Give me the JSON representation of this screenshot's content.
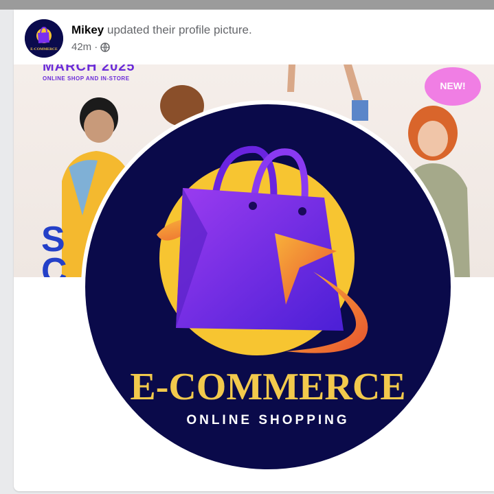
{
  "post": {
    "author": "Mikey",
    "action": "updated their profile picture.",
    "time": "42m",
    "separator": "·",
    "privacy_icon": "globe-icon"
  },
  "cover": {
    "title": "MARCH 2025",
    "subtitle": "ONLINE SHOP AND IN-STORE",
    "badge": "NEW!",
    "partial_letters": [
      "S",
      "C"
    ]
  },
  "logo": {
    "title": "E-COMMERCE",
    "subtitle": "ONLINE SHOPPING",
    "avatar_text": "E-COMMERCE",
    "colors": {
      "background": "#0a0a4a",
      "sun": "#f7c531",
      "bag": "#7a2ff0",
      "swoosh": "#f07a3a",
      "title": "#f2c94c",
      "subtitle": "#ffffff"
    }
  }
}
